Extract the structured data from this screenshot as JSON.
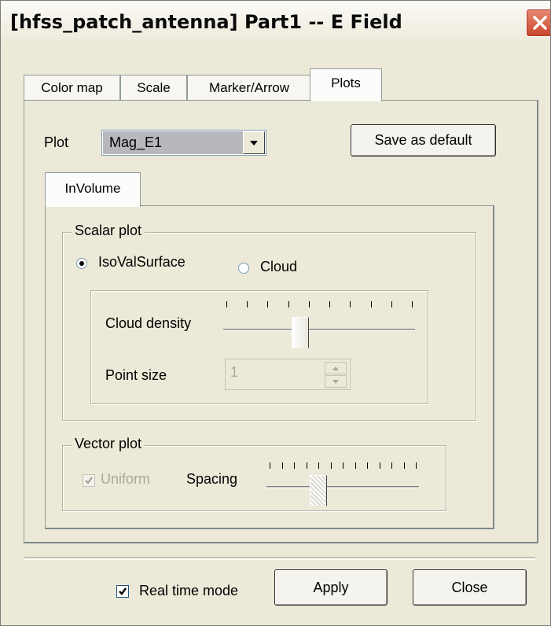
{
  "window": {
    "title": "[hfss_patch_antenna] Part1 -- E Field"
  },
  "tabs": [
    {
      "label": "Color map"
    },
    {
      "label": "Scale"
    },
    {
      "label": "Marker/Arrow"
    },
    {
      "label": "Plots",
      "active": true
    }
  ],
  "plot": {
    "label": "Plot",
    "selected": "Mag_E1",
    "save_default_label": "Save as default"
  },
  "inner_tab": {
    "label": "InVolume"
  },
  "scalar_plot": {
    "title": "Scalar plot",
    "isovalsurface_label": "IsoValSurface",
    "cloud_label": "Cloud",
    "selected": "IsoValSurface",
    "cloud_density_label": "Cloud density",
    "cloud_density_value": 0.39,
    "point_size_label": "Point size",
    "point_size_value": "1"
  },
  "vector_plot": {
    "title": "Vector plot",
    "uniform_label": "Uniform",
    "uniform_checked": true,
    "spacing_label": "Spacing",
    "spacing_value": 0.32
  },
  "footer": {
    "realtime_label": "Real time mode",
    "realtime_checked": true,
    "apply_label": "Apply",
    "close_label": "Close"
  },
  "colors": {
    "face": "#ECE9D8",
    "close_button": "#D4552F",
    "disabled_text": "#ACA899"
  },
  "icons": [
    "close-icon",
    "chevron-down-icon",
    "spin-up-icon",
    "spin-down-icon",
    "check-icon"
  ]
}
